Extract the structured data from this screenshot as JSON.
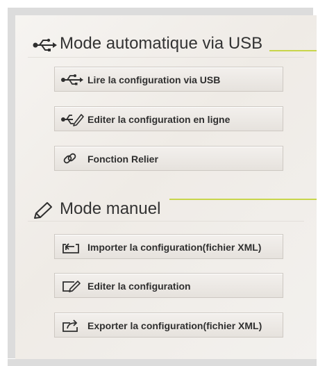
{
  "sections": [
    {
      "title": "Mode automatique via USB",
      "icon": "usb-icon",
      "buttons": [
        {
          "label": "Lire la configuration via USB",
          "icon": "usb-icon"
        },
        {
          "label": "Editer la configuration en ligne",
          "icon": "usb-edit-icon"
        },
        {
          "label": "Fonction Relier",
          "icon": "link-icon"
        }
      ]
    },
    {
      "title": "Mode manuel",
      "icon": "pencil-icon",
      "buttons": [
        {
          "label": "Importer la configuration(fichier XML)",
          "icon": "import-icon"
        },
        {
          "label": "Editer la configuration",
          "icon": "edit-icon"
        },
        {
          "label": "Exporter la configuration(fichier XML)",
          "icon": "export-icon"
        }
      ]
    }
  ],
  "colors": {
    "accent": "#c8d54a",
    "text": "#333333",
    "panel": "#f3f0ec",
    "frame": "#dcdcdc"
  }
}
